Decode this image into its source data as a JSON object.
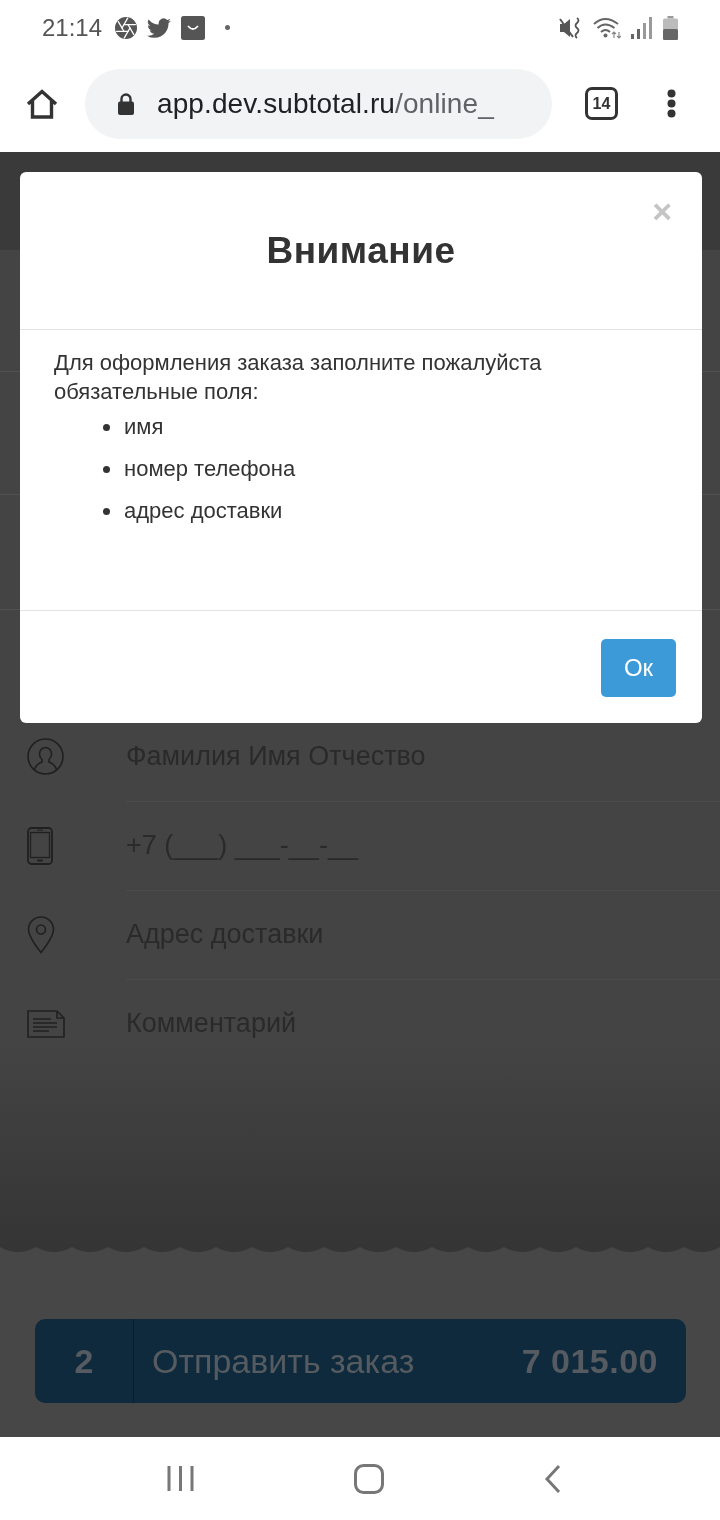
{
  "status_bar": {
    "time": "21:14"
  },
  "browser": {
    "url_host": "app.dev.subtotal.ru",
    "url_path": "/online_",
    "tab_count": "14"
  },
  "modal": {
    "title": "Внимание",
    "close": "×",
    "message": "Для оформления заказа заполните пожалуйста обязательные поля:",
    "required_fields": [
      "имя",
      "номер телефона",
      "адрес доставки"
    ],
    "buttons": [
      "Ок"
    ]
  },
  "form": {
    "fields": [
      {
        "kind": "name",
        "placeholder": "Фамилия Имя Отчество"
      },
      {
        "kind": "phone",
        "placeholder": "+7 (___) ___-__-__"
      },
      {
        "kind": "address",
        "placeholder": "Адрес доставки"
      },
      {
        "kind": "comment",
        "placeholder": "Комментарий"
      }
    ]
  },
  "order_bar": {
    "count": "2",
    "label": "Отправить заказ",
    "total": "7 015.00"
  }
}
